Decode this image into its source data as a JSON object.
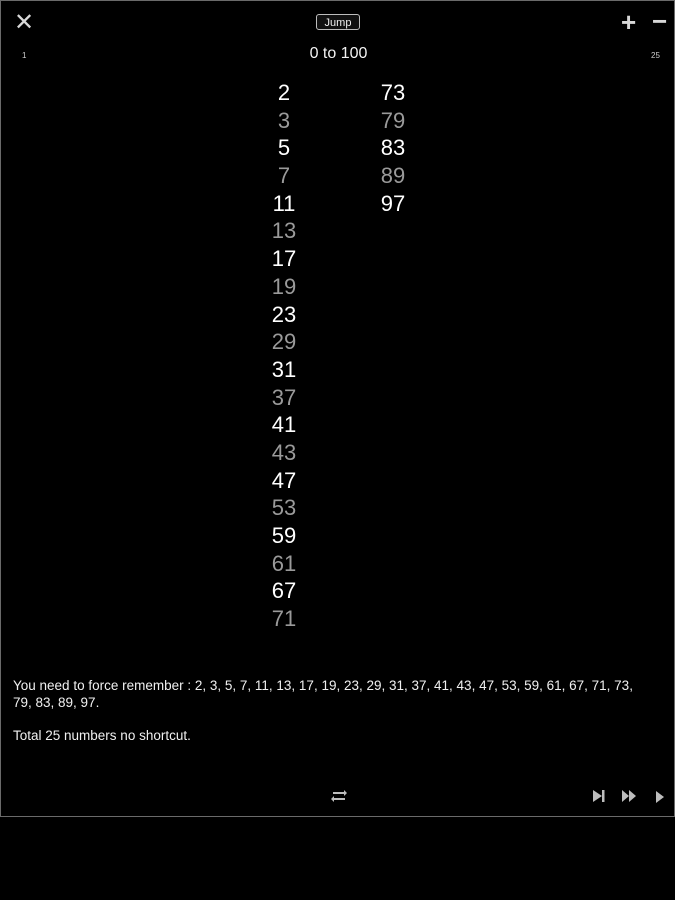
{
  "toolbar": {
    "close_icon": "close-icon",
    "jump_label": "Jump",
    "plus_icon": "plus-icon",
    "minus_icon": "minus-icon"
  },
  "range": {
    "min_label": "1",
    "max_label": "25",
    "title": "0 to 100"
  },
  "numbers": {
    "column1": [
      "2",
      "3",
      "5",
      "7",
      "11",
      "13",
      "17",
      "19",
      "23",
      "29",
      "31",
      "37",
      "41",
      "43",
      "47",
      "53",
      "59",
      "61",
      "67",
      "71"
    ],
    "column2": [
      "73",
      "79",
      "83",
      "89",
      "97"
    ]
  },
  "info": {
    "remember_text": "You need to force remember : 2, 3, 5, 7, 11, 13, 17, 19, 23, 29, 31, 37, 41, 43, 47, 53, 59, 61, 67, 71, 73, 79, 83, 89, 97.",
    "total_text": "Total 25 numbers no shortcut."
  },
  "bottom_bar": {
    "icons": [
      "repeat-icon",
      "skip-end-icon",
      "fast-forward-icon",
      "play-icon"
    ]
  },
  "colors": {
    "background": "#000000",
    "bright_number": "#ffffff",
    "dim_number": "#9a9a9a",
    "icon": "#bdbdbd"
  }
}
